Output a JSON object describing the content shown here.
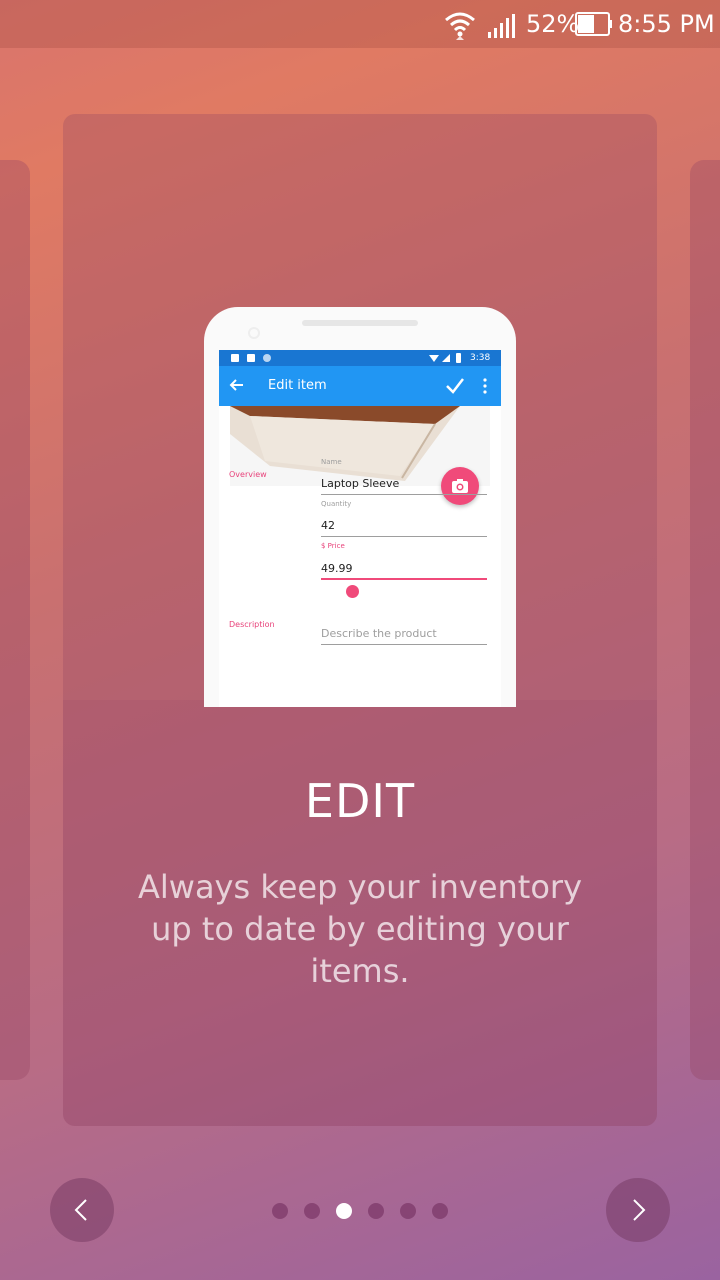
{
  "status_bar": {
    "battery_percent": "52%",
    "time": "8:55 PM",
    "icons": [
      "wifi-icon",
      "signal-icon",
      "battery-icon"
    ]
  },
  "slide": {
    "title": "EDIT",
    "description": "Always keep your inventory up to date by editing your items."
  },
  "mockup": {
    "status_time": "3:38",
    "appbar_title": "Edit item",
    "section_overview": "Overview",
    "section_description": "Description",
    "name_label": "Name",
    "name_value": "Laptop Sleeve",
    "quantity_label": "Quantity",
    "quantity_value": "42",
    "price_label": "$ Price",
    "price_value": "49.99",
    "description_placeholder": "Describe the product",
    "colors": {
      "appbar": "#2196f3",
      "status": "#1976d2",
      "accent": "#f04a7a"
    }
  },
  "pager": {
    "page_count": 6,
    "active_index": 2
  },
  "colors": {
    "bg_top": "#e07a63",
    "bg_bottom": "#9a63a0"
  }
}
